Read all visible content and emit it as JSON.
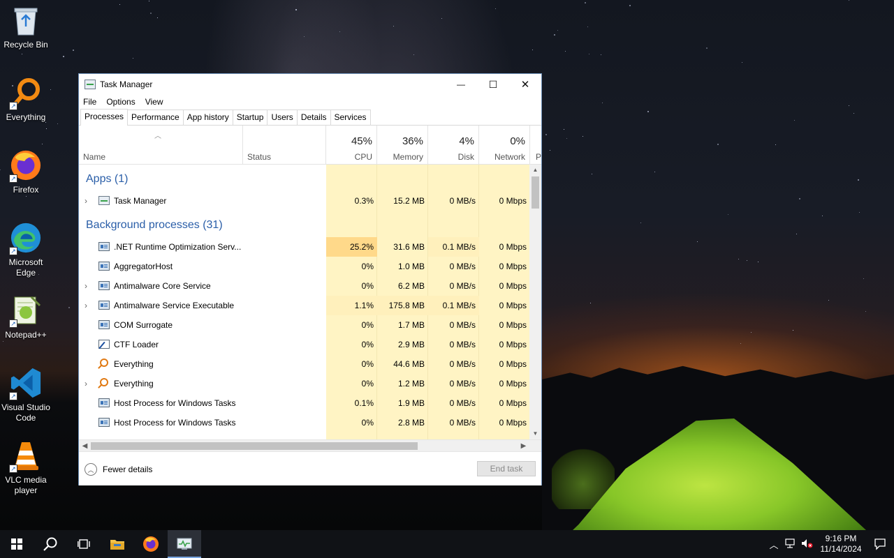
{
  "desktop": {
    "icons": [
      {
        "label": "Recycle Bin",
        "icon": "recycle-bin-icon"
      },
      {
        "label": "Everything",
        "icon": "everything-search-icon"
      },
      {
        "label": "Firefox",
        "icon": "firefox-icon"
      },
      {
        "label": "Microsoft Edge",
        "icon": "edge-icon"
      },
      {
        "label": "Notepad++",
        "icon": "notepadpp-icon"
      },
      {
        "label": "Visual Studio Code",
        "icon": "vscode-icon"
      },
      {
        "label": "VLC media player",
        "icon": "vlc-icon"
      }
    ]
  },
  "window": {
    "title": "Task Manager",
    "controls": {
      "minimize": "—",
      "maximize": "☐",
      "close": "✕"
    },
    "menu": [
      "File",
      "Options",
      "View"
    ],
    "tabs": [
      "Processes",
      "Performance",
      "App history",
      "Startup",
      "Users",
      "Details",
      "Services"
    ],
    "active_tab": "Processes",
    "columns": {
      "name": "Name",
      "status": "Status",
      "cpu": {
        "pct": "45%",
        "label": "CPU"
      },
      "memory": {
        "pct": "36%",
        "label": "Memory"
      },
      "disk": {
        "pct": "4%",
        "label": "Disk"
      },
      "network": {
        "pct": "0%",
        "label": "Network"
      },
      "overflow": "P"
    },
    "groups": {
      "apps": "Apps (1)",
      "background": "Background processes (31)"
    },
    "apps_rows": [
      {
        "name": "Task Manager",
        "cpu": "0.3%",
        "memory": "15.2 MB",
        "disk": "0 MB/s",
        "network": "0 Mbps",
        "expandable": true,
        "icon": "task-manager-icon"
      }
    ],
    "bg_rows": [
      {
        "name": ".NET Runtime Optimization Serv...",
        "cpu": "25.2%",
        "memory": "31.6 MB",
        "disk": "0.1 MB/s",
        "network": "0 Mbps",
        "expandable": false,
        "icon": "service-icon"
      },
      {
        "name": "AggregatorHost",
        "cpu": "0%",
        "memory": "1.0 MB",
        "disk": "0 MB/s",
        "network": "0 Mbps",
        "expandable": false,
        "icon": "service-icon"
      },
      {
        "name": "Antimalware Core Service",
        "cpu": "0%",
        "memory": "6.2 MB",
        "disk": "0 MB/s",
        "network": "0 Mbps",
        "expandable": true,
        "icon": "service-icon"
      },
      {
        "name": "Antimalware Service Executable",
        "cpu": "1.1%",
        "memory": "175.8 MB",
        "disk": "0.1 MB/s",
        "network": "0 Mbps",
        "expandable": true,
        "icon": "service-icon"
      },
      {
        "name": "COM Surrogate",
        "cpu": "0%",
        "memory": "1.7 MB",
        "disk": "0 MB/s",
        "network": "0 Mbps",
        "expandable": false,
        "icon": "service-icon"
      },
      {
        "name": "CTF Loader",
        "cpu": "0%",
        "memory": "2.9 MB",
        "disk": "0 MB/s",
        "network": "0 Mbps",
        "expandable": false,
        "icon": "ctf-loader-icon"
      },
      {
        "name": "Everything",
        "cpu": "0%",
        "memory": "44.6 MB",
        "disk": "0 MB/s",
        "network": "0 Mbps",
        "expandable": false,
        "icon": "everything-search-icon"
      },
      {
        "name": "Everything",
        "cpu": "0%",
        "memory": "1.2 MB",
        "disk": "0 MB/s",
        "network": "0 Mbps",
        "expandable": true,
        "icon": "everything-search-icon"
      },
      {
        "name": "Host Process for Windows Tasks",
        "cpu": "0.1%",
        "memory": "1.9 MB",
        "disk": "0 MB/s",
        "network": "0 Mbps",
        "expandable": false,
        "icon": "service-icon"
      },
      {
        "name": "Host Process for Windows Tasks",
        "cpu": "0%",
        "memory": "2.8 MB",
        "disk": "0 MB/s",
        "network": "0 Mbps",
        "expandable": false,
        "icon": "service-icon"
      }
    ],
    "footer": {
      "fewer_details": "Fewer details",
      "end_task": "End task"
    }
  },
  "taskbar": {
    "apps": [
      "start-icon",
      "search-icon",
      "task-view-icon",
      "file-explorer-icon",
      "firefox-icon",
      "task-manager-icon"
    ],
    "active_app": "task-manager-icon",
    "tray": {
      "time": "9:16 PM",
      "date": "11/14/2024"
    }
  }
}
